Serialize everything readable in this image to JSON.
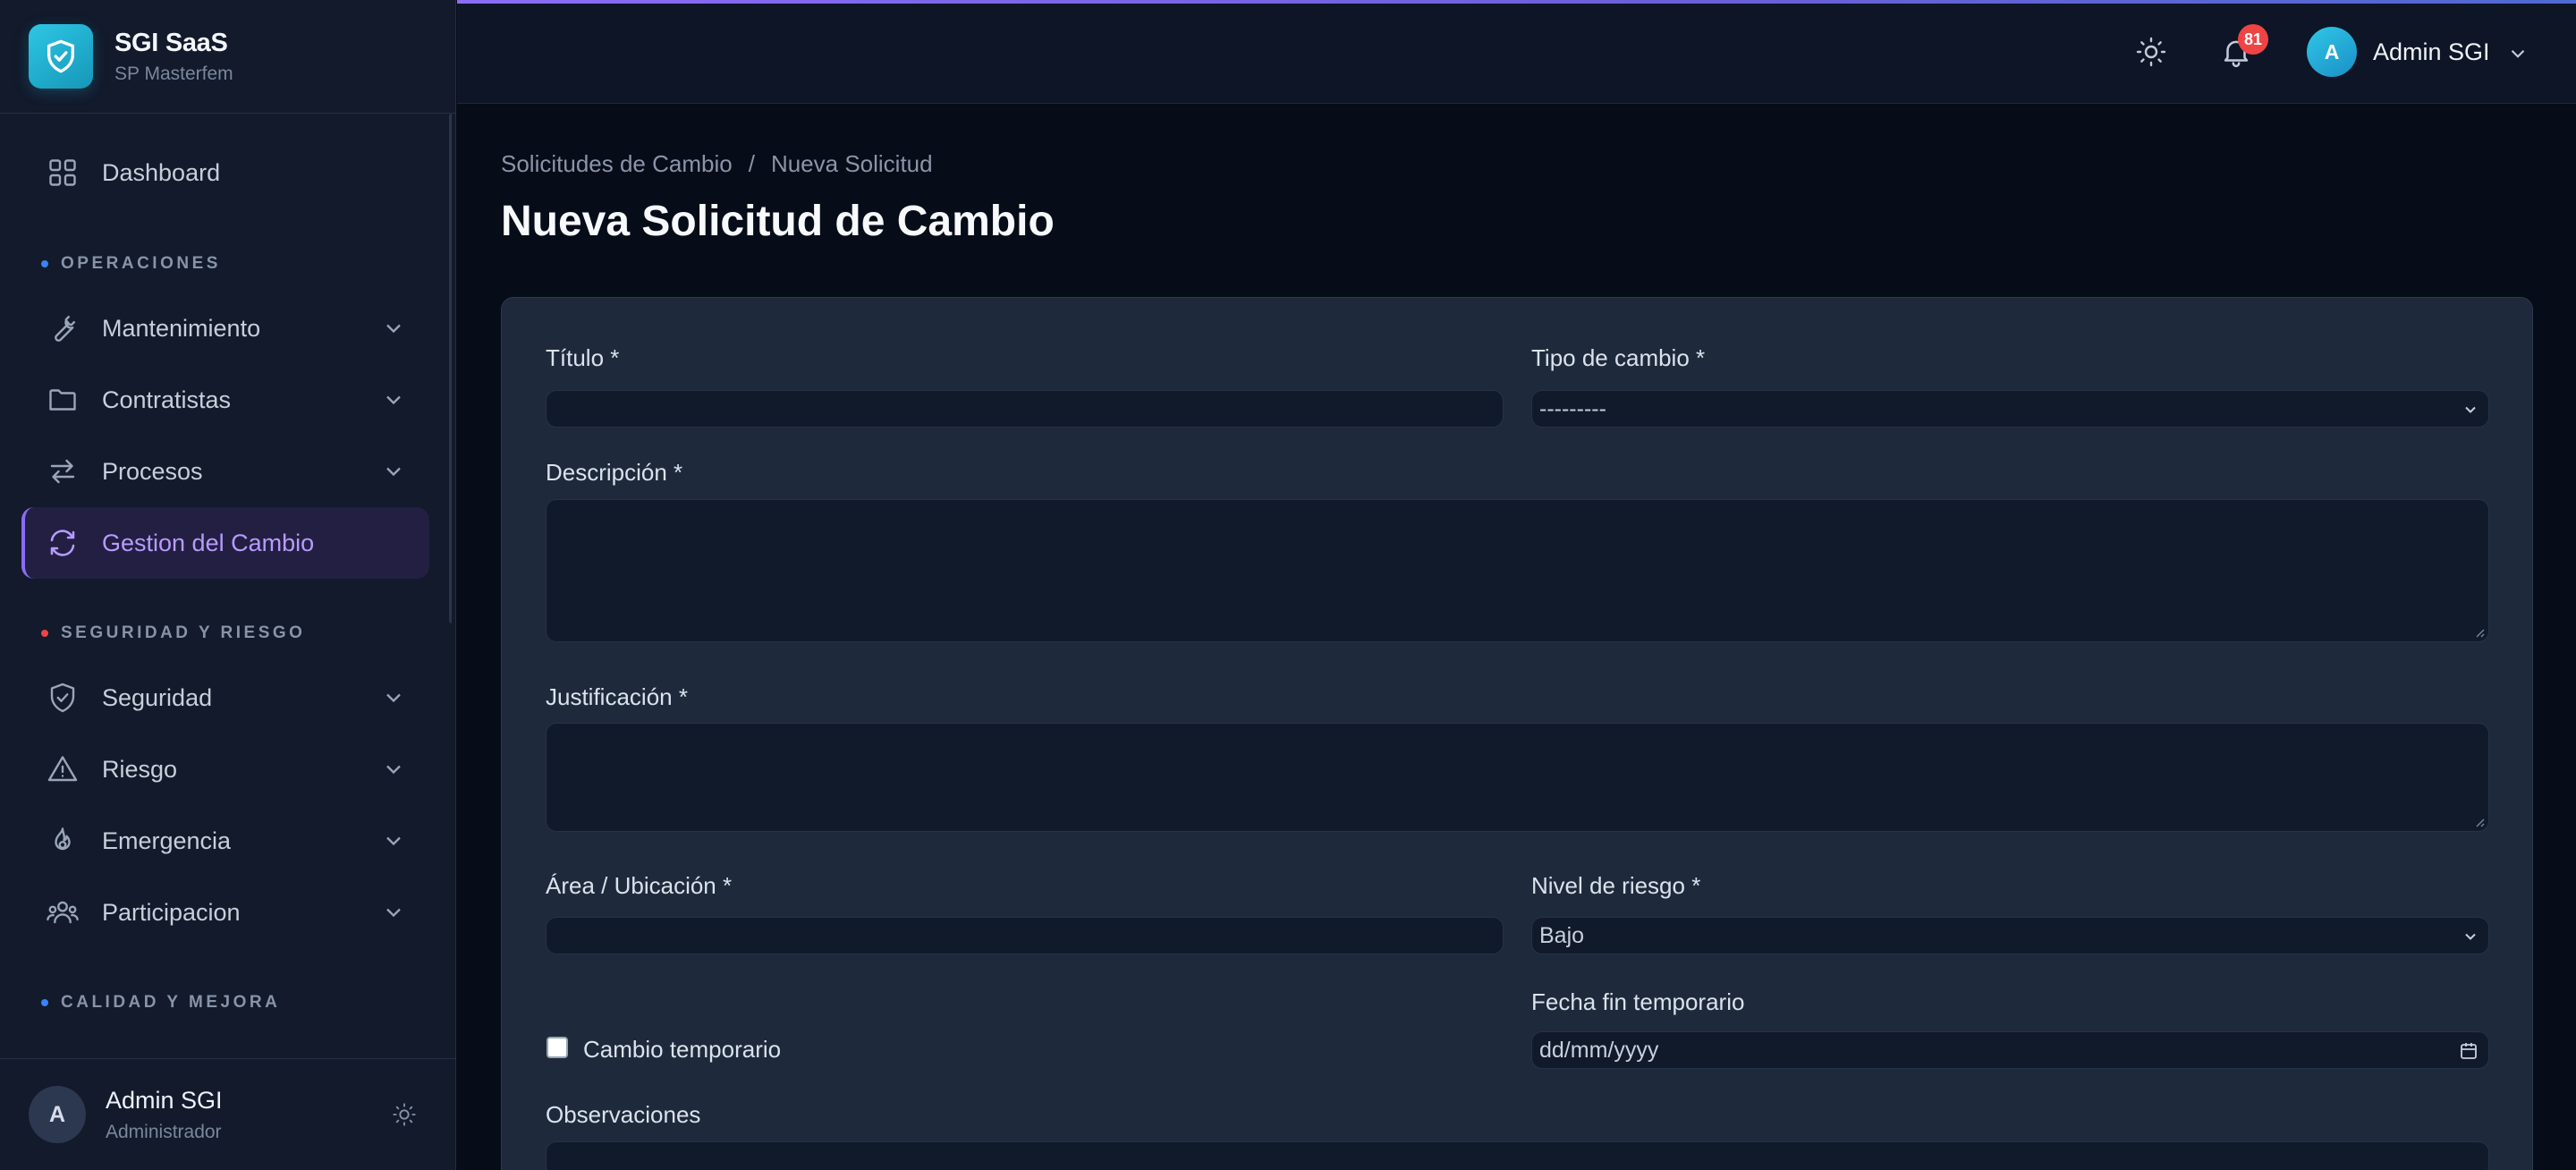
{
  "brand": {
    "name": "SGI SaaS",
    "subtitle": "SP Masterfem"
  },
  "sidebar": {
    "dashboard": "Dashboard",
    "sections": [
      {
        "label": "OPERACIONES",
        "dot_color": "#3b82f6"
      },
      {
        "label": "SEGURIDAD Y RIESGO",
        "dot_color": "#ef4444"
      },
      {
        "label": "CALIDAD Y MEJORA",
        "dot_color": "#3b82f6"
      }
    ],
    "items": [
      {
        "label": "Mantenimiento",
        "icon": "wrench-icon"
      },
      {
        "label": "Contratistas",
        "icon": "folder-icon"
      },
      {
        "label": "Procesos",
        "icon": "arrows-swap-icon"
      },
      {
        "label": "Gestion del Cambio",
        "icon": "refresh-icon",
        "active": true
      },
      {
        "label": "Seguridad",
        "icon": "shield-check-icon"
      },
      {
        "label": "Riesgo",
        "icon": "warning-icon"
      },
      {
        "label": "Emergencia",
        "icon": "flame-icon"
      },
      {
        "label": "Participacion",
        "icon": "users-icon"
      }
    ],
    "user": {
      "name": "Admin SGI",
      "role": "Administrador",
      "initial": "A"
    }
  },
  "topbar": {
    "notifications_count": "81",
    "user_name": "Admin SGI",
    "user_initial": "A",
    "accent_color": "#8b6cf6"
  },
  "breadcrumb": {
    "parent": "Solicitudes de Cambio",
    "separator": "/",
    "current": "Nueva Solicitud"
  },
  "page_title": "Nueva Solicitud de Cambio",
  "form": {
    "titulo": {
      "label": "Título *",
      "value": ""
    },
    "tipo_cambio": {
      "label": "Tipo de cambio *",
      "value": "---------"
    },
    "descripcion": {
      "label": "Descripción *",
      "value": ""
    },
    "justificacion": {
      "label": "Justificación *",
      "value": ""
    },
    "area": {
      "label": "Área / Ubicación *",
      "value": ""
    },
    "nivel_riesgo": {
      "label": "Nivel de riesgo *",
      "value": "Bajo"
    },
    "temporal": {
      "label": "Cambio temporario",
      "checked": false
    },
    "fecha_fin": {
      "label": "Fecha fin temporario",
      "placeholder": "dd/mm/yyyy"
    },
    "observaciones": {
      "label": "Observaciones"
    }
  }
}
